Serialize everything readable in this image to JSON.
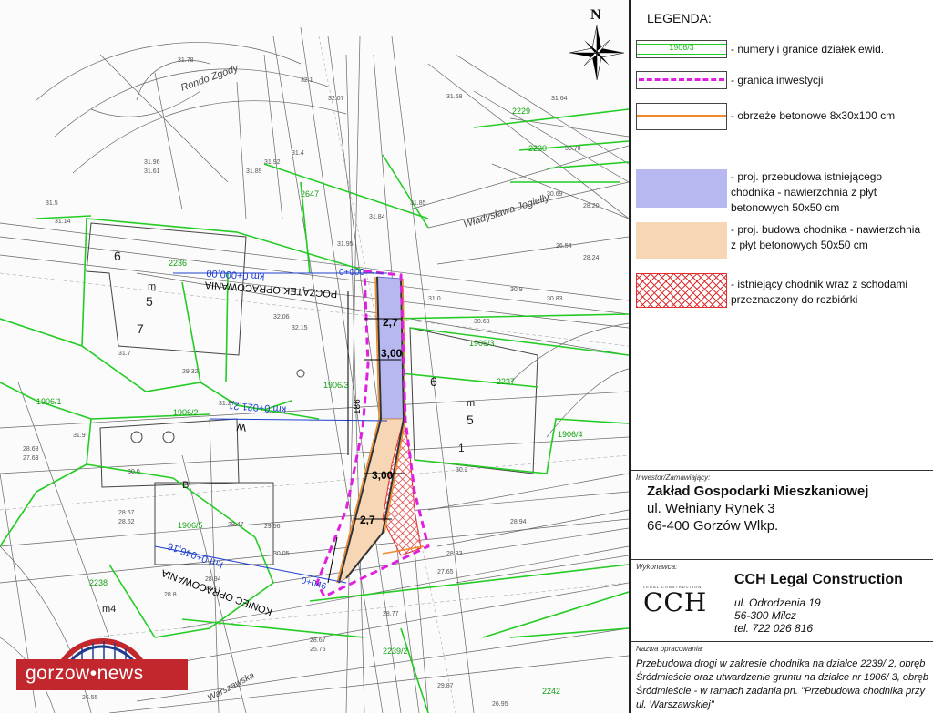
{
  "map": {
    "north_label": "N",
    "labels": {
      "poczatek": "POCZĄTEK OPRACOWANIA",
      "km_start": "km 0+000,00",
      "km_start_line": "0+000",
      "km_mid": "km 0+021,21",
      "km_mid_w": "W",
      "koniec": "KONIEC OPRACOWANIA",
      "km_end": "km 0+046,16",
      "km_end_line": "0+046",
      "rondo": "Rondo Zgody",
      "jogiella": "Władysława Jogiełły",
      "warszawska": "Warszawska",
      "width_1": "2,7",
      "width_2": "3,00",
      "width_3": "3,00",
      "width_4": "2,7",
      "len": "186",
      "parcel_1906_3": "1906/3",
      "parcel_1906_3b": "1906/3",
      "parcel_1906_5": "1906/5",
      "parcel_1906_1": "1906/1",
      "parcel_1906_2": "1906/2",
      "parcel_1906_4": "1906/4",
      "parcel_2237": "2237",
      "parcel_2236": "2236",
      "parcel_2238": "2238",
      "parcel_2239_2": "2239/2",
      "parcel_2229": "2229",
      "parcel_2230": "2230",
      "parcel_2242": "2242",
      "parcel_2647": "2647",
      "b6_left": "6",
      "b5_left": "5",
      "b7_left": "7",
      "m_left": "m",
      "b6_right": "6",
      "b5_right": "5",
      "m_right": "m",
      "b1_right": "1",
      "m4": "m4",
      "B": "B"
    }
  },
  "legend": {
    "title": "LEGENDA:",
    "items": [
      {
        "symbol_label": "1906/3",
        "text": "- numery i granice działek ewid."
      },
      {
        "text": "- granica inwestycji"
      },
      {
        "text": "- obrzeże betonowe 8x30x100 cm"
      },
      {
        "text": "- proj. przebudowa istniejącego\nchodnika - nawierzchnia z płyt\nbetonowych 50x50 cm"
      },
      {
        "text": "- proj. budowa chodnika - nawierzchnia\nz płyt betonowych 50x50 cm"
      },
      {
        "text": "- istniejący chodnik wraz z schodami\nprzeznaczony do rozbiórki"
      }
    ],
    "colors": {
      "parcel_green": "#22cc22",
      "boundary_magenta": "#e020e0",
      "curb_orange": "#f08a2a",
      "blue_fill": "#b8b8f0",
      "orange_fill": "#f6d6b4",
      "hatch_red": "#e03030"
    }
  },
  "investor": {
    "heading": "Inwestor/Zamawiający:",
    "name": "Zakład Gospodarki Mieszkaniowej",
    "line1": "ul. Wełniany Rynek 3",
    "line2": "66-400 Gorzów Wlkp."
  },
  "contractor": {
    "heading": "Wykonawca:",
    "logo": "CCH",
    "logo_sub": "LEGAL CONSTRUCTION",
    "name": "CCH Legal Construction",
    "addr1": "ul. Odrodzenia 19",
    "addr2": "56-300 Milcz",
    "addr3": "tel. 722 026 816"
  },
  "project": {
    "heading": "Nazwa opracowania:",
    "text": "Przebudowa drogi w zakresie chodnika na działce 2239/ 2, obręb Śródmieście oraz utwardzenie gruntu na działce nr 1906/ 3, obręb Śródmieście - w ramach zadania pn. \"Przebudowa chodnika przy ul. Warszawskiej\""
  },
  "watermark": {
    "text": "gorzow",
    "dot": "•",
    "text2": "news",
    "colors": {
      "red": "#c1272d",
      "blue": "#1e3c8c"
    }
  }
}
